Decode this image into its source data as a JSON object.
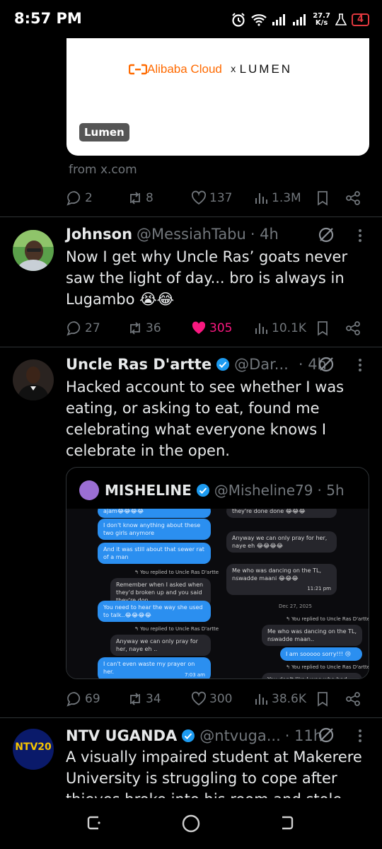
{
  "status_bar": {
    "time": "8:57 PM",
    "net_speed_value": "27.7",
    "net_speed_unit": "K/s",
    "battery": "4",
    "icons": [
      "alarm-icon",
      "wifi-icon",
      "signal-icon",
      "signal-icon",
      "lab-icon",
      "battery-icon"
    ]
  },
  "tweets": [
    {
      "card": {
        "logo_left": "Alibaba Cloud",
        "logo_x": "x",
        "logo_right": "LUMEN",
        "badge": "Lumen"
      },
      "source": "from x.com",
      "replies": "2",
      "reposts": "8",
      "likes": "137",
      "views": "1.3M"
    },
    {
      "name": "Johnson",
      "handle": "@MessiahTabu",
      "time": "· 4h",
      "text": "Now I get why Uncle Ras’ goats never saw the light of day... bro is always in Lugambo 😭😂",
      "replies": "27",
      "reposts": "36",
      "likes": "305",
      "liked": true,
      "views": "10.1K"
    },
    {
      "name": "Uncle Ras D'artte",
      "handle": "@Dar...",
      "time": "· 4h",
      "verified": true,
      "text": "Hacked account to see whether I was eating, or asking to eat, found me celebrating what everyone knows I celebrate in the open.",
      "quote": {
        "name": "MISHELINE",
        "handle": "@Misheline79",
        "time": "· 5h",
        "chat": {
          "left": {
            "b1": "ajam😂😂😂😂",
            "b2": "I don't know anything about these two girls anymore",
            "b3": "And it was still about that sewer rat of a man",
            "r1": "↰ You replied to Uncle Ras D'artte",
            "b4": "Remember when I asked when they'd broken up and you said they're don..",
            "b5": "You need to hear the way she used to talk..😂😂😂😂",
            "r2": "↰ You replied to Uncle Ras D'artte",
            "b6": "Anyway we can only pray for her, naye eh ..",
            "b7": "I can't even waste my prayer on her.",
            "t7": "7:03 am"
          },
          "right": {
            "b1": "they're done done 😂😂😂",
            "b2": "Anyway we can only pray for her, naye eh 😂😂😂😂",
            "b3": "Me who was dancing on the TL, nswadde maani 😂😂😂",
            "t3": "11:21 pm",
            "date": "Dec 27, 2025",
            "r1": "↰ You replied to Uncle Ras D'artte",
            "b4": "Me who was dancing on the TL, nswadde maan..",
            "b5": "I am sooooo sorry!!! 😢",
            "r2": "↰ You replied to Uncle Ras D'artte",
            "b6": "You don't like I was who had done.."
          }
        }
      },
      "replies": "69",
      "reposts": "34",
      "likes": "300",
      "views": "38.6K"
    },
    {
      "name": "NTV UGANDA",
      "handle": "@ntvuga...",
      "time": "· 11h",
      "verified": true,
      "avatar_text": "NTV20",
      "text": "A visually impaired student at Makerere University is struggling to cope after thieves broke into his room and stole his"
    }
  ],
  "colors": {
    "background": "#000000",
    "text": "#e7e9ea",
    "muted": "#71767b",
    "like": "#f91880",
    "verified": "#1d9bf0",
    "divider": "#2f3336"
  }
}
